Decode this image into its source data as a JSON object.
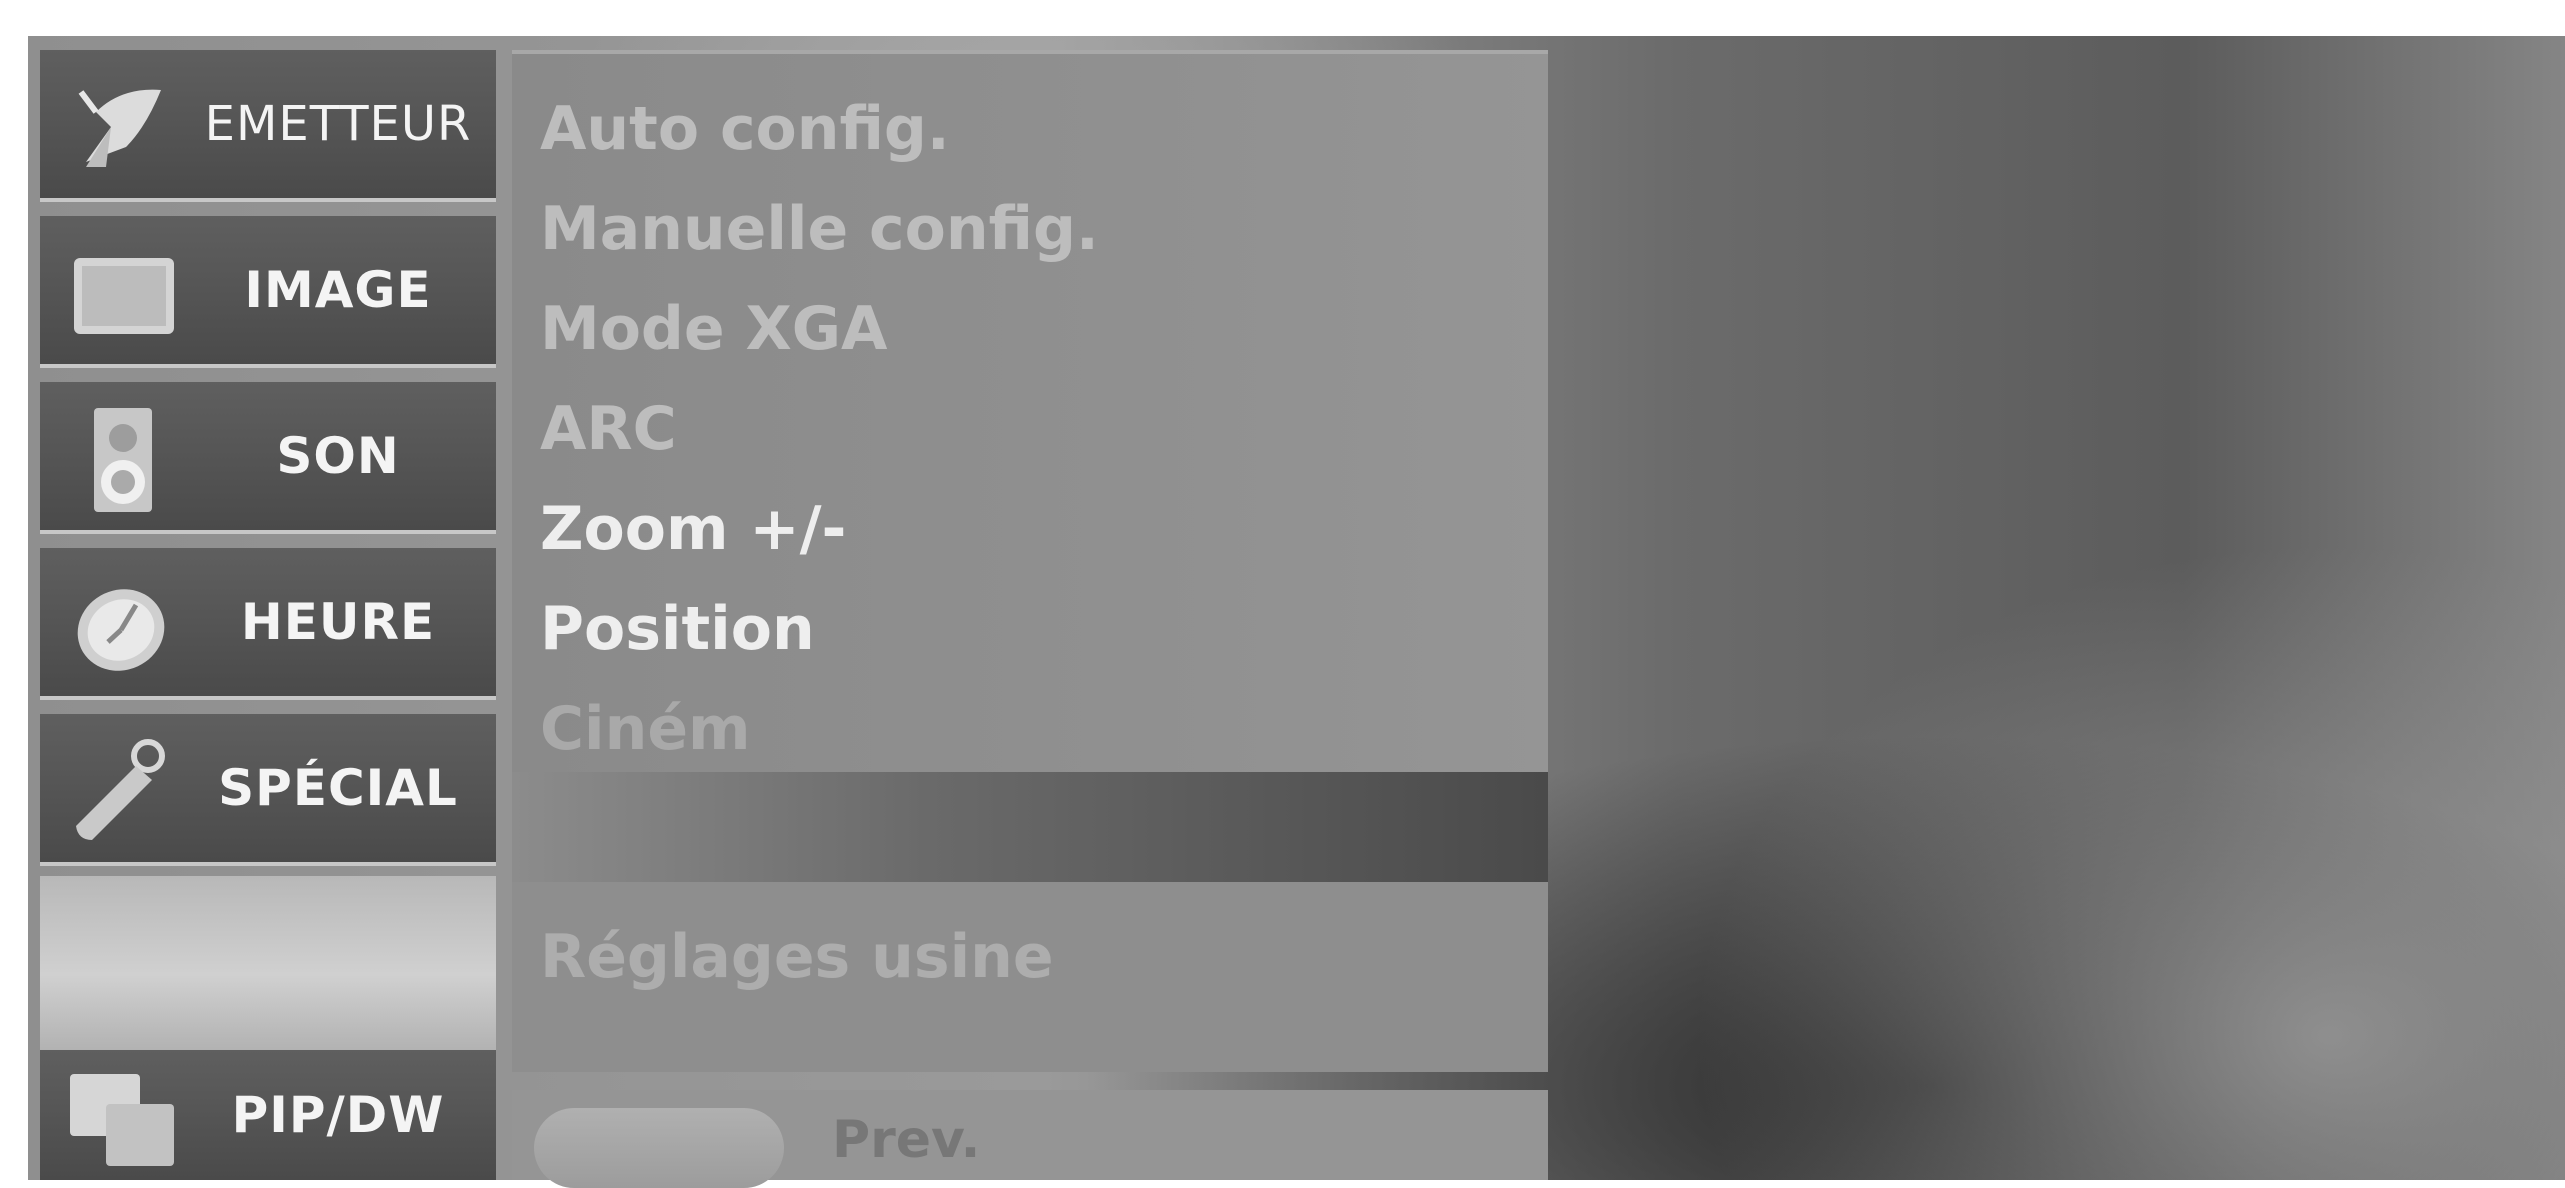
{
  "menu": {
    "items": [
      {
        "label": "EMETTEUR",
        "icon": "satellite-dish-icon"
      },
      {
        "label": "IMAGE",
        "icon": "picture-icon"
      },
      {
        "label": "SON",
        "icon": "speaker-icon"
      },
      {
        "label": "HEURE",
        "icon": "clock-icon"
      },
      {
        "label": "SPÉCIAL",
        "icon": "tag-icon"
      },
      {
        "label": "PIP/DW",
        "icon": "pip-icon"
      }
    ]
  },
  "submenu": {
    "options": [
      "Auto config.",
      "Manuelle config.",
      "Mode XGA",
      "ARC",
      "Zoom +/-",
      "Position",
      "Ciném"
    ],
    "reset": "Réglages usine",
    "prev": "Prev."
  }
}
